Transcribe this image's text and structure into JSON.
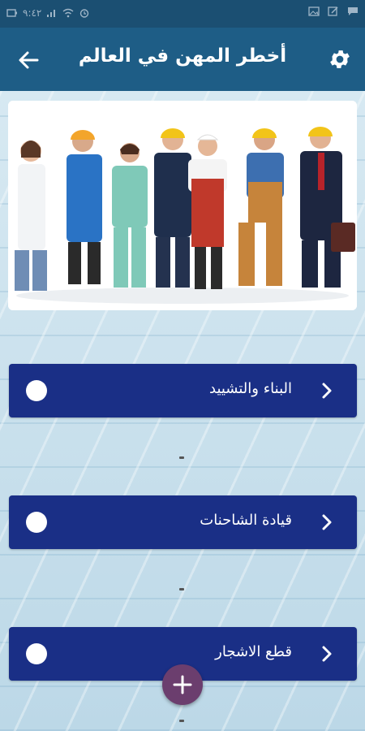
{
  "status_bar": {
    "time": "٩:٤٢",
    "left_icons": [
      "battery-icon",
      "signal-icon",
      "wifi-icon",
      "alarm-icon"
    ],
    "right_icons": [
      "chat-icon",
      "edit-icon",
      "image-icon"
    ]
  },
  "header": {
    "title": "أخطر المهن في العالم",
    "back_icon": "arrow-left-icon",
    "settings_icon": "gear-icon"
  },
  "hero": {
    "description": "workers-group-image"
  },
  "items": [
    {
      "label": "البناء والتشييد"
    },
    {
      "label": "قيادة الشاحنات"
    },
    {
      "label": "قطع الاشجار"
    }
  ],
  "fab": {
    "icon": "plus-icon"
  },
  "colors": {
    "app_bar": "#1e5d86",
    "status_bar": "#1b4f72",
    "item_bg": "#1a2f86",
    "fab": "#6b3e6e"
  }
}
